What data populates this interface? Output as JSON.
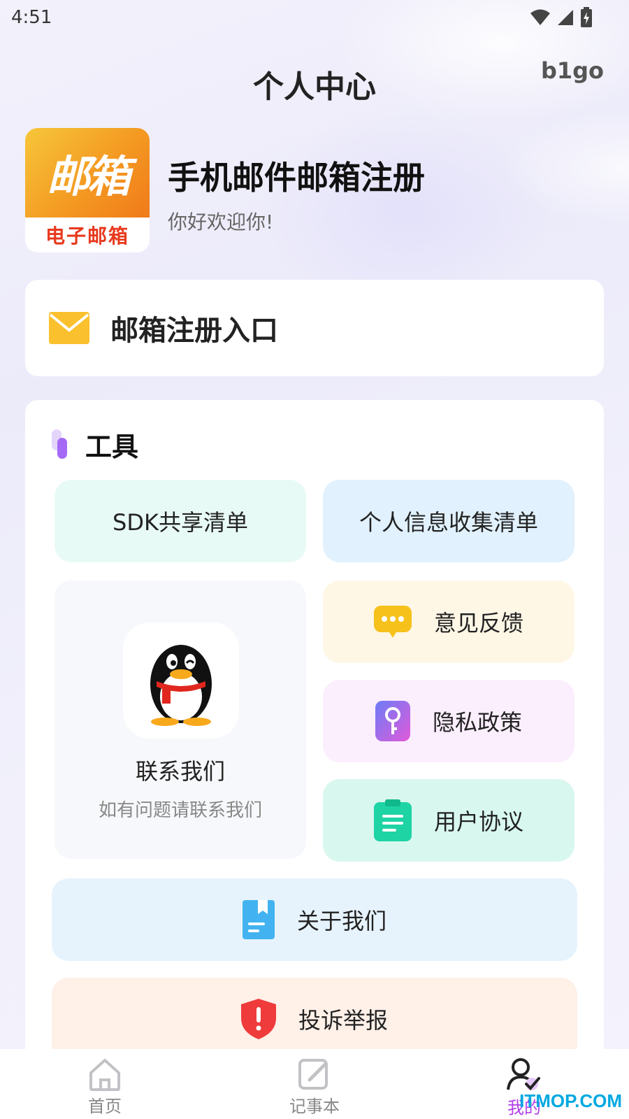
{
  "status_bar": {
    "time": "4:51"
  },
  "header": {
    "title": "个人中心",
    "user": "b1go"
  },
  "app": {
    "logo_main": "邮箱",
    "logo_sub": "电子邮箱",
    "name": "手机邮件邮箱注册",
    "greeting": "你好欢迎你!"
  },
  "entry": {
    "label": "邮箱注册入口",
    "icon": "mail-icon"
  },
  "tools": {
    "title": "工具",
    "sdk_list": "SDK共享清单",
    "personal_info_list": "个人信息收集清单",
    "feedback": "意见反馈",
    "privacy": "隐私政策",
    "user_agreement": "用户协议",
    "about": "关于我们",
    "complaint": "投诉举报",
    "contact": {
      "title": "联系我们",
      "subtitle": "如有问题请联系我们"
    }
  },
  "nav": {
    "items": [
      {
        "label": "首页",
        "icon": "home-icon"
      },
      {
        "label": "记事本",
        "icon": "notepad-icon"
      },
      {
        "label": "我的",
        "icon": "profile-icon"
      }
    ],
    "active_color": "#b23fe8"
  },
  "watermark": "ITMOP.COM"
}
